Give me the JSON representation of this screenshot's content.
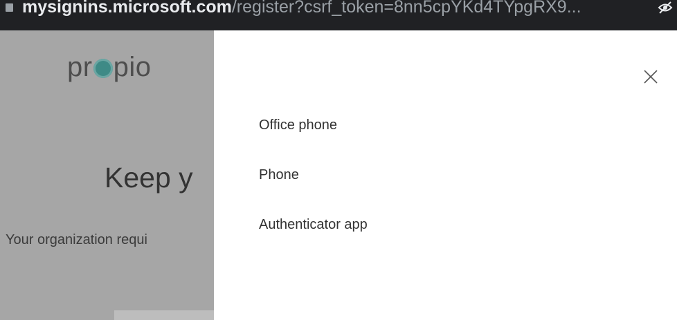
{
  "browser": {
    "url_host": "mysignins.microsoft.com",
    "url_path": "/register?csrf_token=8nn5cpYKd4TYpgRX9..."
  },
  "background": {
    "logo_left": "pr",
    "logo_right": "pio",
    "heading": "Keep y",
    "subtext": "Your organization requi"
  },
  "panel": {
    "options": [
      {
        "label": "Office phone"
      },
      {
        "label": "Phone"
      },
      {
        "label": "Authenticator app"
      }
    ]
  },
  "colors": {
    "overlay": "#a6a6a6",
    "panel": "#ffffff",
    "logo_accent": "#3e8a86"
  },
  "icons": {
    "close": "close-icon",
    "lock": "lock-icon",
    "eye": "eye-off-icon"
  }
}
